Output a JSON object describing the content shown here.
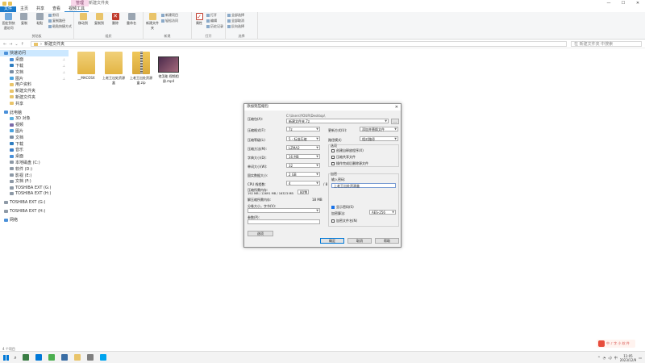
{
  "window": {
    "context_tab": "管理",
    "title": "新建文件夹",
    "controls": [
      "—",
      "☐",
      "✕"
    ]
  },
  "ribbon_tabs": [
    "文件",
    "主页",
    "共享",
    "查看",
    "视频工具"
  ],
  "ribbon": {
    "clipboard": {
      "pin": "固定到快速访问",
      "copy": "复制",
      "paste": "粘贴",
      "cut": "剪切",
      "copy_path": "复制路径",
      "paste_shortcut": "粘贴快捷方式",
      "label": "剪贴板"
    },
    "organize": {
      "move_to": "移动到",
      "copy_to": "复制到",
      "delete": "删除",
      "rename": "重命名",
      "label": "组织"
    },
    "new": {
      "new_folder": "新建文件夹",
      "new_item": "新建项目",
      "easy_access": "轻松访问",
      "label": "新建"
    },
    "open": {
      "properties": "属性",
      "open": "打开",
      "edit": "编辑",
      "history": "历史记录",
      "label": "打开"
    },
    "select": {
      "select_all": "全部选择",
      "select_none": "全部取消",
      "invert": "反向选择",
      "label": "选择"
    }
  },
  "address": {
    "path": "新建文件夹",
    "search_placeholder": "在 新建文件夹 中搜索"
  },
  "sidebar": [
    {
      "label": "快速访问",
      "color": "#4a90d9",
      "sel": true
    },
    {
      "label": "桌面",
      "color": "#4a90d9",
      "pin": "📌",
      "sub": true
    },
    {
      "label": "下载",
      "color": "#2f7dc0",
      "pin": "📌",
      "sub": true
    },
    {
      "label": "文档",
      "color": "#7a8da3",
      "pin": "📌",
      "sub": true
    },
    {
      "label": "图片",
      "color": "#4aa3df",
      "pin": "📌",
      "sub": true
    },
    {
      "label": "用户资料",
      "color": "#e9c46a",
      "sub": true
    },
    {
      "label": "新建文件夹",
      "color": "#e9c46a",
      "sub": true
    },
    {
      "label": "新建文件夹",
      "color": "#e9c46a",
      "sub": true
    },
    {
      "label": "共享",
      "color": "#e9c46a",
      "sub": true
    },
    {
      "gap": true
    },
    {
      "label": "此电脑",
      "color": "#4a90d9"
    },
    {
      "label": "3D 对象",
      "color": "#5bb0e0",
      "sub": true
    },
    {
      "label": "视频",
      "color": "#7a6aa8",
      "sub": true
    },
    {
      "label": "图片",
      "color": "#4aa3df",
      "sub": true
    },
    {
      "label": "文档",
      "color": "#7a8da3",
      "sub": true
    },
    {
      "label": "下载",
      "color": "#2f7dc0",
      "sub": true
    },
    {
      "label": "音乐",
      "color": "#3a7ec8",
      "sub": true
    },
    {
      "label": "桌面",
      "color": "#4a90d9",
      "sub": true
    },
    {
      "label": "本地磁盘 (C:)",
      "color": "#8d99a6",
      "sub": true
    },
    {
      "label": "软件 (D:)",
      "color": "#8d99a6",
      "sub": true
    },
    {
      "label": "影视 (E:)",
      "color": "#8d99a6",
      "sub": true
    },
    {
      "label": "文档 (F:)",
      "color": "#8d99a6",
      "sub": true
    },
    {
      "label": "TOSHIBA EXT (G:)",
      "color": "#8d99a6",
      "sub": true
    },
    {
      "label": "TOSHIBA EXT (H:)",
      "color": "#8d99a6",
      "sub": true
    },
    {
      "gap": true
    },
    {
      "label": "TOSHIBA EXT (G:)",
      "color": "#8d99a6"
    },
    {
      "gap": true
    },
    {
      "label": "TOSHIBA EXT (H:)",
      "color": "#8d99a6"
    },
    {
      "gap": true
    },
    {
      "label": "网络",
      "color": "#4a90d9"
    }
  ],
  "files": [
    {
      "name": "__MACOSX",
      "kind": "folder"
    },
    {
      "name": "上老王出处资源盒",
      "kind": "folder"
    },
    {
      "name": "上老王出处资源盒.zip",
      "kind": "zip"
    },
    {
      "name": "他怎能 视频相册.mp4",
      "kind": "video"
    }
  ],
  "status": "4 个项目",
  "dialog": {
    "title": "添加到压缩包",
    "close": "✕",
    "archive_label": "压缩包(A):",
    "archive_dir": "C:\\Users\\YOUR\\Desktop\\",
    "archive_name": "新建文件夹.7z",
    "browse": "...",
    "format_label": "压缩格式(F):",
    "format_value": "7z",
    "level_label": "压缩等级(L):",
    "level_value": "5 - 标准压缩",
    "method_label": "压缩方法(M):",
    "method_value": "LZMA2",
    "dict_label": "字典大小(D):",
    "dict_value": "16 MB",
    "word_label": "单词大小(W):",
    "word_value": "32",
    "solid_label": "固实数据大小:",
    "solid_value": "2 GB",
    "cpu_label": "CPU 线程数:",
    "cpu_value": "4",
    "cpu_total": "/ 8",
    "mem_label": "压缩所需内存:",
    "mem_value": "192 MB / 12691 MB / 16323 MB",
    "mem_pct": "80%",
    "decomp_label": "解压缩所需内存:",
    "decomp_value": "18 MB",
    "split_label": "分卷大小，字节(V):",
    "split_value": "",
    "params_label": "参数(P):",
    "params_value": "",
    "options_button": "选项",
    "update_label": "更新方式(U):",
    "update_value": "添加并替换文件",
    "pathmode_label": "路径模式:",
    "pathmode_value": "相对路径",
    "opts_title": "选项",
    "opt1": "创建自释放程序(X)",
    "opt2": "压缩共享文件",
    "opt3": "操作完成后删除源文件",
    "enc_title": "加密",
    "pwd_label": "输入密码:",
    "pwd_value": "上老王出处资源盒",
    "show_pwd": "显示密码(S)",
    "enc_method_label": "加密算法:",
    "enc_method_value": "AES-256",
    "enc_names": "加密文件名(N)",
    "ok": "确定",
    "cancel": "取消",
    "help": "帮助"
  },
  "taskbar": {
    "time": "11:05",
    "date": "2023/12/9",
    "lang": "中",
    "apps": [
      "#3a7d44",
      "#0078d7",
      "#4caf50",
      "#3a6ea5",
      "#e9c46a",
      "#7f7f7f",
      "#00a4ef"
    ]
  },
  "watermark": "中 ♪ 字 小 软 件"
}
